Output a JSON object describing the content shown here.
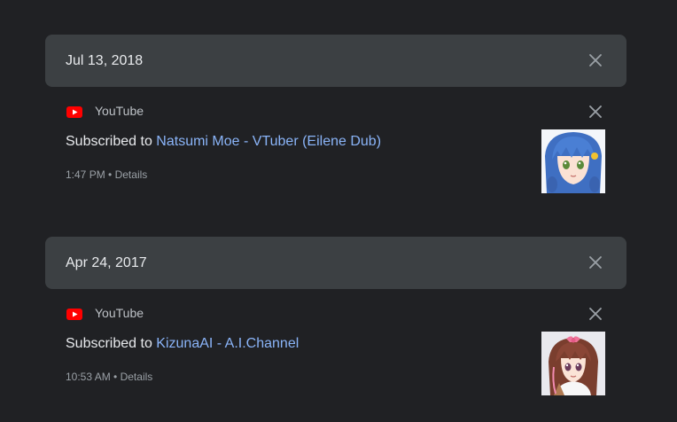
{
  "entries": [
    {
      "date": "Jul 13, 2018",
      "product": "YouTube",
      "prefix": "Subscribed to",
      "channel": "Natsumi Moe - VTuber (Eilene Dub)",
      "time": "1:47 PM",
      "separator": "•",
      "details_label": "Details",
      "thumbnail": "anime-girl-blue-hair-avatar"
    },
    {
      "date": "Apr 24, 2017",
      "product": "YouTube",
      "prefix": "Subscribed to",
      "channel": "KizunaAI - A.I.Channel",
      "time": "10:53 AM",
      "separator": "•",
      "details_label": "Details",
      "thumbnail": "anime-girl-brown-hair-pink-ribbon-avatar"
    }
  ],
  "icons": {
    "close": "close-icon",
    "product": "youtube-icon"
  },
  "colors": {
    "background": "#202124",
    "card": "#3c4043",
    "link": "#8ab4f8",
    "youtube_red": "#ff0000"
  }
}
